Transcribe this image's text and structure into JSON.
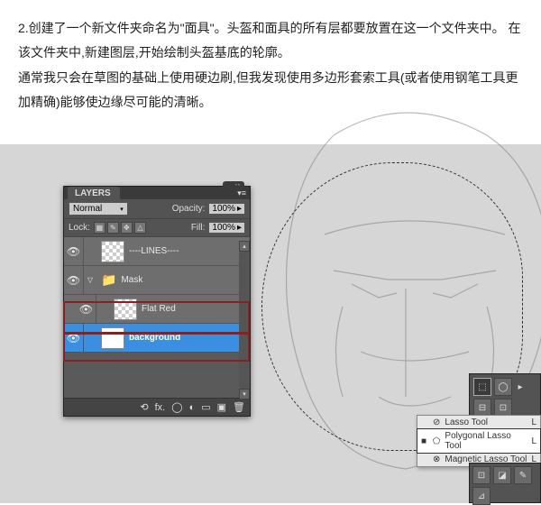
{
  "instructions": {
    "p1": "2.创建了一个新文件夹命名为\"面具\"。头盔和面具的所有层都要放置在这一个文件夹中。  在该文件夹中,新建图层,开始绘制头盔基底的轮廓。",
    "p2": "  通常我只会在草图的基础上使用硬边刷,但我发现使用多边形套索工具(或者使用钢笔工具更加精确)能够使边缘尽可能的清晰。"
  },
  "layers_panel": {
    "tab_label": "LAYERS",
    "blend_mode": "Normal",
    "opacity_label": "Opacity:",
    "opacity_value": "100%",
    "lock_label": "Lock:",
    "fill_label": "Fill:",
    "fill_value": "100%",
    "items": [
      {
        "name": "----LINES----",
        "group": false,
        "nested": false,
        "thumb": "trans"
      },
      {
        "name": "Mask",
        "group": true,
        "nested": false
      },
      {
        "name": "Flat Red",
        "group": false,
        "nested": true,
        "thumb": "trans"
      },
      {
        "name": "background",
        "group": false,
        "nested": false,
        "thumb": "white",
        "selected": true
      }
    ]
  },
  "lasso_menu": {
    "items": [
      {
        "label": "Lasso Tool",
        "key": "L",
        "selected": false
      },
      {
        "label": "Polygonal Lasso Tool",
        "key": "L",
        "selected": true
      },
      {
        "label": "Magnetic Lasso Tool",
        "key": "L",
        "selected": false
      }
    ]
  }
}
